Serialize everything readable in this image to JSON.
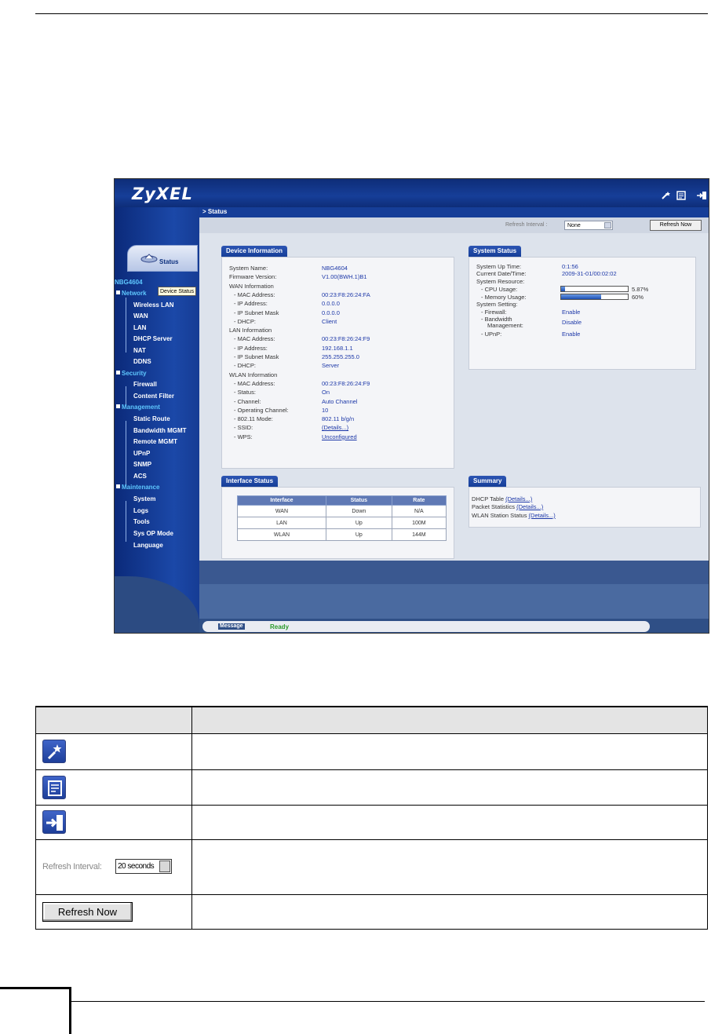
{
  "router": {
    "logo": "ZyXEL",
    "breadcrumb": "Status",
    "status_tab": "Status",
    "nav": {
      "model": "NBG4604",
      "tooltip": "Device Status",
      "sections": [
        {
          "label": "Network",
          "items": [
            "Wireless LAN",
            "WAN",
            "LAN",
            "DHCP Server",
            "NAT",
            "DDNS"
          ]
        },
        {
          "label": "Security",
          "items": [
            "Firewall",
            "Content Filter"
          ]
        },
        {
          "label": "Management",
          "items": [
            "Static Route",
            "Bandwidth MGMT",
            "Remote MGMT",
            "UPnP",
            "SNMP",
            "ACS"
          ]
        },
        {
          "label": "Maintenance",
          "items": [
            "System",
            "Logs",
            "Tools",
            "Sys OP Mode",
            "Language"
          ]
        }
      ]
    },
    "toolbar": {
      "refresh_label": "Refresh Interval :",
      "refresh_value": "None",
      "refresh_button": "Refresh Now"
    },
    "device_info": {
      "title": "Device Information",
      "rows": [
        {
          "label": "System Name:",
          "value": "NBG4604"
        },
        {
          "label": "Firmware Version:",
          "value": "V1.00(BWH.1)B1"
        },
        {
          "label": "WAN Information",
          "value": ""
        },
        {
          "label": "- MAC Address:",
          "value": "00:23:F8:26:24:FA"
        },
        {
          "label": "- IP Address:",
          "value": "0.0.0.0"
        },
        {
          "label": "- IP Subnet Mask",
          "value": "0.0.0.0"
        },
        {
          "label": "- DHCP:",
          "value": "Client"
        },
        {
          "label": "LAN Information",
          "value": ""
        },
        {
          "label": "- MAC Address:",
          "value": "00:23:F8:26:24:F9"
        },
        {
          "label": "- IP Address:",
          "value": "192.168.1.1"
        },
        {
          "label": "- IP Subnet Mask",
          "value": "255.255.255.0"
        },
        {
          "label": "- DHCP:",
          "value": "Server"
        },
        {
          "label": "WLAN Information",
          "value": ""
        },
        {
          "label": "- MAC Address:",
          "value": "00:23:F8:26:24:F9"
        },
        {
          "label": "- Status:",
          "value": "On"
        },
        {
          "label": "- Channel:",
          "value": "Auto Channel"
        },
        {
          "label": "- Operating Channel:",
          "value": "10"
        },
        {
          "label": "- 802.11 Mode:",
          "value": "802.11 b/g/n"
        },
        {
          "label": "- SSID:",
          "value": "(Details...)"
        },
        {
          "label": "- WPS:",
          "value": "Unconfigured"
        }
      ]
    },
    "system_status": {
      "title": "System Status",
      "uptime_label": "System Up Time:",
      "uptime": "0:1:56",
      "datetime_label": "Current Date/Time:",
      "datetime": "2009-31-01/00:02:02",
      "resource_label": "System Resource:",
      "cpu_label": "- CPU Usage:",
      "cpu_text": "5.87%",
      "cpu_pct": 5.87,
      "mem_label": "- Memory Usage:",
      "mem_text": "60%",
      "mem_pct": 60,
      "setting_label": "System Setting:",
      "firewall_label": "- Firewall:",
      "firewall": "Enable",
      "bw_label1": "- Bandwidth",
      "bw_label2": "Management:",
      "bw": "Disable",
      "upnp_label": "- UPnP:",
      "upnp": "Enable"
    },
    "interface_status": {
      "title": "Interface Status",
      "headers": [
        "Interface",
        "Status",
        "Rate"
      ],
      "rows": [
        [
          "WAN",
          "Down",
          "N/A"
        ],
        [
          "LAN",
          "Up",
          "100M"
        ],
        [
          "WLAN",
          "Up",
          "144M"
        ]
      ]
    },
    "summary": {
      "title": "Summary",
      "rows": [
        {
          "label": "DHCP Table",
          "link": "(Details...)"
        },
        {
          "label": "Packet Statistics",
          "link": "(Details...)"
        },
        {
          "label": "WLAN Station Status",
          "link": "(Details...)"
        }
      ]
    },
    "message": {
      "label": "Message",
      "text": "Ready"
    }
  },
  "desc_table": {
    "header_1": "",
    "header_2": "",
    "interval_label": "Refresh Interval:",
    "interval_value": "20 seconds",
    "refresh_button": "Refresh Now",
    "icons": [
      "wizard-icon",
      "about-icon",
      "logout-icon"
    ]
  }
}
